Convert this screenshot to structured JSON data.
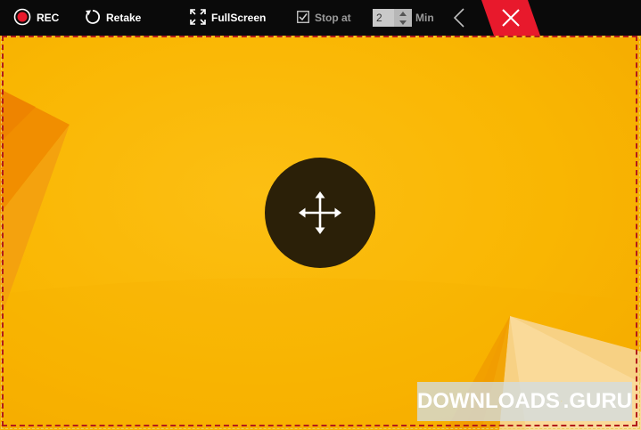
{
  "toolbar": {
    "rec_label": "REC",
    "retake_label": "Retake",
    "fullscreen_label": "FullScreen",
    "stop_at_label": "Stop at",
    "stop_at_checked": true,
    "stop_at_value": "2",
    "min_label": "Min"
  },
  "icons": {
    "rec": "record-icon",
    "retake": "refresh-icon",
    "fullscreen": "expand-icon",
    "stop_at": "checkbox-icon",
    "collapse": "chevron-left-icon",
    "close": "close-icon",
    "move": "move-arrows-icon"
  },
  "watermark": {
    "part1": "DOWNLOADS",
    "part2": ".GURU"
  },
  "colors": {
    "toolbar_bg": "#0a0a0a",
    "rec_red": "#e8192c",
    "close_red": "#e8192c",
    "frame_dash": "#b21b1b",
    "wallpaper": "#f9b602",
    "move_handle": "#2b2008"
  }
}
